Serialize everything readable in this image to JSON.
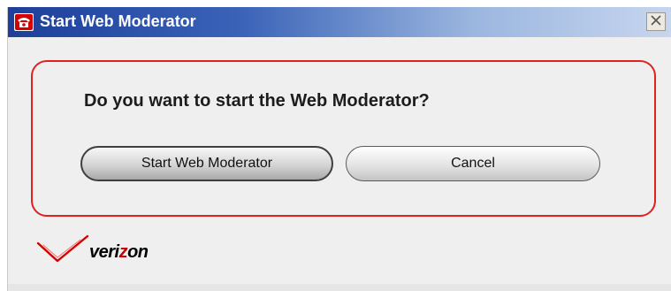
{
  "window": {
    "title": "Start Web Moderator",
    "title_icon": "telephone-icon",
    "close_icon": "close-icon"
  },
  "dialog": {
    "question": "Do you want to start the Web Moderator?",
    "start_button_label": "Start Web Moderator",
    "cancel_button_label": "Cancel"
  },
  "branding": {
    "logo_prefix": "veri",
    "logo_z": "z",
    "logo_suffix": "on",
    "logo_icon": "verizon-check-icon"
  },
  "colors": {
    "titlebar_dark": "#1d3f9a",
    "titlebar_light": "#c7d6ef",
    "panel_border": "#e32020",
    "brand_red": "#cc0000",
    "dialog_background": "#efefef"
  }
}
